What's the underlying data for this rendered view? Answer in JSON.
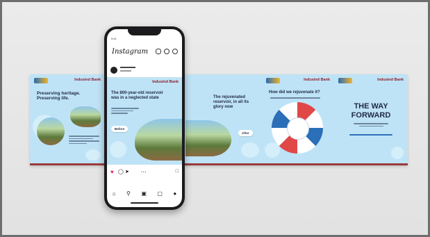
{
  "brand": "Indusind Bank",
  "colors": {
    "background": "#e6e6e6",
    "card": "#bfe3f6",
    "accent": "#8b1e2d",
    "text": "#1f2a44"
  },
  "cards": [
    {
      "headline": "Preserving heritage.\nPreserving life."
    },
    {
      "headline": "The 800-year-old reservoir\nwas in a neglected state",
      "button": "Before"
    },
    {
      "headline": "The rejuvenated\nreservoir, in all its\nglory now",
      "button": "After"
    },
    {
      "headline": "How did we rejuvenate it?"
    },
    {
      "headline": "THE WAY\nFORWARD"
    }
  ],
  "phone": {
    "app_logo": "Instagram",
    "status_time": "9:41",
    "icons": [
      "add-icon",
      "heart-icon",
      "messenger-icon"
    ],
    "nav_icons": [
      "home-icon",
      "search-icon",
      "reels-icon",
      "shop-icon",
      "profile-icon"
    ]
  }
}
